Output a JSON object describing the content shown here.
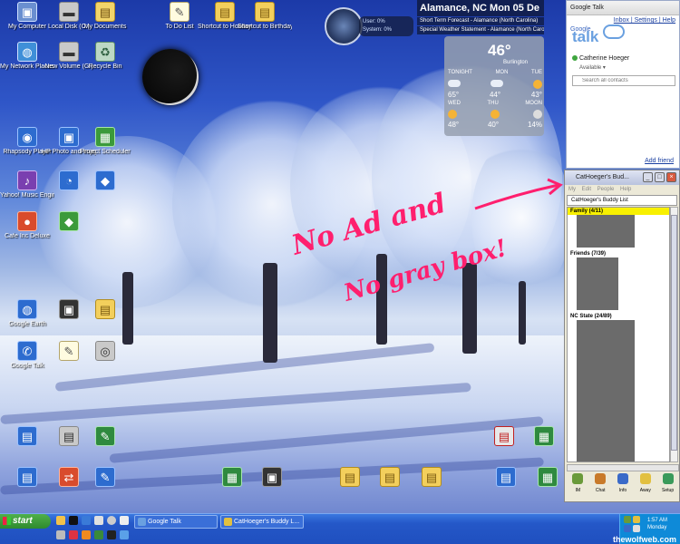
{
  "desktop": {
    "icons": [
      {
        "label": "My Computer",
        "glyph": "▣",
        "style": "g-comp"
      },
      {
        "label": "Local Disk (C:)",
        "glyph": "▬",
        "style": "g-disk"
      },
      {
        "label": "My Documents",
        "glyph": "▤",
        "style": "g-docs"
      },
      {
        "label": "To Do List",
        "glyph": "✎",
        "style": "g-note"
      },
      {
        "label": "Shortcut to Holiday W...",
        "glyph": "▤",
        "style": "g-fold"
      },
      {
        "label": "Shortcut to Birthday Do...",
        "glyph": "▤",
        "style": "g-fold"
      },
      {
        "label": "My Network Places",
        "glyph": "◍",
        "style": "g-net"
      },
      {
        "label": "New Volume (G:)",
        "glyph": "▬",
        "style": "g-disk"
      },
      {
        "label": "Recycle Bin",
        "glyph": "♻",
        "style": "g-bin"
      },
      {
        "label": "Rhapsody Player",
        "glyph": "◉",
        "style": "g-app"
      },
      {
        "label": "HP Photo and Imaging G...",
        "glyph": "▣",
        "style": "g-app"
      },
      {
        "label": "Project Scheduler",
        "glyph": "▦",
        "style": "g-grn"
      },
      {
        "label": "Yahoo! Music Engine",
        "glyph": "♪",
        "style": "g-purp"
      },
      {
        "label": "",
        "glyph": "◔",
        "style": "g-app"
      },
      {
        "label": "",
        "glyph": "◆",
        "style": "g-app"
      },
      {
        "label": "Cafe Inc Deluxe",
        "glyph": "●",
        "style": "g-red"
      },
      {
        "label": "",
        "glyph": "◆",
        "style": "g-grn"
      },
      {
        "label": "Google Earth",
        "glyph": "◍",
        "style": "g-app"
      },
      {
        "label": "",
        "glyph": "▣",
        "style": "g-dark"
      },
      {
        "label": "",
        "glyph": "▤",
        "style": "g-fold"
      },
      {
        "label": "Google Talk",
        "glyph": "✆",
        "style": "g-app"
      },
      {
        "label": "",
        "glyph": "✎",
        "style": "g-note"
      },
      {
        "label": "",
        "glyph": "◎",
        "style": "g-disk"
      },
      {
        "label": "",
        "glyph": "▤",
        "style": "g-app"
      },
      {
        "label": "",
        "glyph": "▤",
        "style": "g-disk"
      },
      {
        "label": "",
        "glyph": "✎",
        "style": "g-xl"
      },
      {
        "label": "",
        "glyph": "▤",
        "style": "g-pdf"
      },
      {
        "label": "",
        "glyph": "▦",
        "style": "g-xl"
      },
      {
        "label": "",
        "glyph": "▤",
        "style": "g-app"
      },
      {
        "label": "",
        "glyph": "⇄",
        "style": "g-red"
      },
      {
        "label": "",
        "glyph": "✎",
        "style": "g-app"
      },
      {
        "label": "",
        "glyph": "▦",
        "style": "g-xl"
      },
      {
        "label": "",
        "glyph": "▣",
        "style": "g-dark"
      },
      {
        "label": "",
        "glyph": "▤",
        "style": "g-fold"
      },
      {
        "label": "",
        "glyph": "▤",
        "style": "g-fold"
      },
      {
        "label": "",
        "glyph": "▤",
        "style": "g-fold"
      },
      {
        "label": "",
        "glyph": "▤",
        "style": "g-app"
      },
      {
        "label": "",
        "glyph": "▦",
        "style": "g-xl"
      }
    ]
  },
  "meter": {
    "user": "User: 0%",
    "system": "System: 0%"
  },
  "weather": {
    "header": "Alamance, NC Mon 05 De",
    "ticker1": "Short Term Forecast - Alamance (North Carolina)",
    "ticker2": "Special Weather Statement - Alamance (North Carolina)",
    "temp": "46°",
    "city": "Burlington",
    "days1": [
      "TONIGHT",
      "MON",
      "TUE"
    ],
    "temps1": [
      "65°",
      "44°",
      "43°"
    ],
    "days2": [
      "WED",
      "THU",
      "MOON"
    ],
    "temps2": [
      "48°",
      "40°",
      "14%"
    ]
  },
  "gtalk": {
    "title": "Google Talk",
    "links": "Inbox | Settings | Help",
    "logo_g": "Google",
    "logo_talk": "talk",
    "user": "Catherine Hoeger",
    "status": "Available ▾",
    "search_placeholder": "Search all contacts",
    "add_friend": "Add friend"
  },
  "buddy": {
    "title": "CatHoeger's Bud...",
    "menu": "My Edit People Help",
    "list_header": "CatHoeger's Buddy List",
    "groups": [
      "Family (4/11)",
      "Friends (7/39)",
      "NC State (24/89)"
    ],
    "tools": [
      "IM",
      "Chat",
      "Info",
      "Away",
      "Setup"
    ]
  },
  "annotation": {
    "line1": "No Ad and",
    "line2": "No gray box!"
  },
  "taskbar": {
    "start": "start",
    "tasks": [
      "Google Talk",
      "CatHoeger's Buddy L..."
    ],
    "time": "1:57 AM",
    "day": "Monday"
  },
  "watermark": "thewolfweb.com",
  "colors": {
    "annotation": "#ff1f6e",
    "taskbar": "#2558c8",
    "highlight": "#f8f000"
  }
}
